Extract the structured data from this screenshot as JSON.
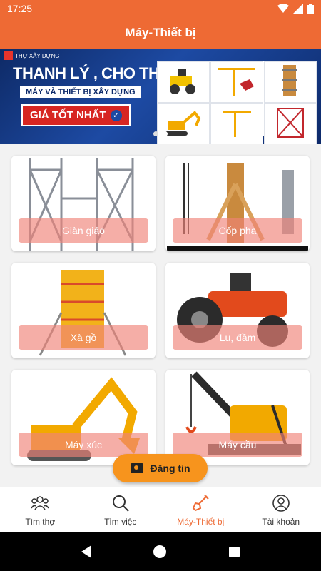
{
  "status": {
    "time": "17:25"
  },
  "header": {
    "title": "Máy-Thiết bị"
  },
  "banner": {
    "brand": "THỢ XÂY DỰNG",
    "line1": "THANH LÝ , CHO THUÊ",
    "line2": "MÁY VÀ THIẾT BỊ XÂY DỰNG",
    "price": "GIÁ TỐT NHẤT"
  },
  "categories": [
    {
      "label": "Giàn giáo"
    },
    {
      "label": "Cốp pha"
    },
    {
      "label": "Xà gồ"
    },
    {
      "label": "Lu, đầm"
    },
    {
      "label": "Máy xúc"
    },
    {
      "label": "Máy cầu"
    }
  ],
  "fab": {
    "label": "Đăng tin"
  },
  "nav": {
    "items": [
      {
        "label": "Tìm thợ"
      },
      {
        "label": "Tìm việc"
      },
      {
        "label": "Máy-Thiết bị"
      },
      {
        "label": "Tài khoản"
      }
    ]
  },
  "colors": {
    "primary": "#ee6a34",
    "fab": "#f7941d"
  }
}
